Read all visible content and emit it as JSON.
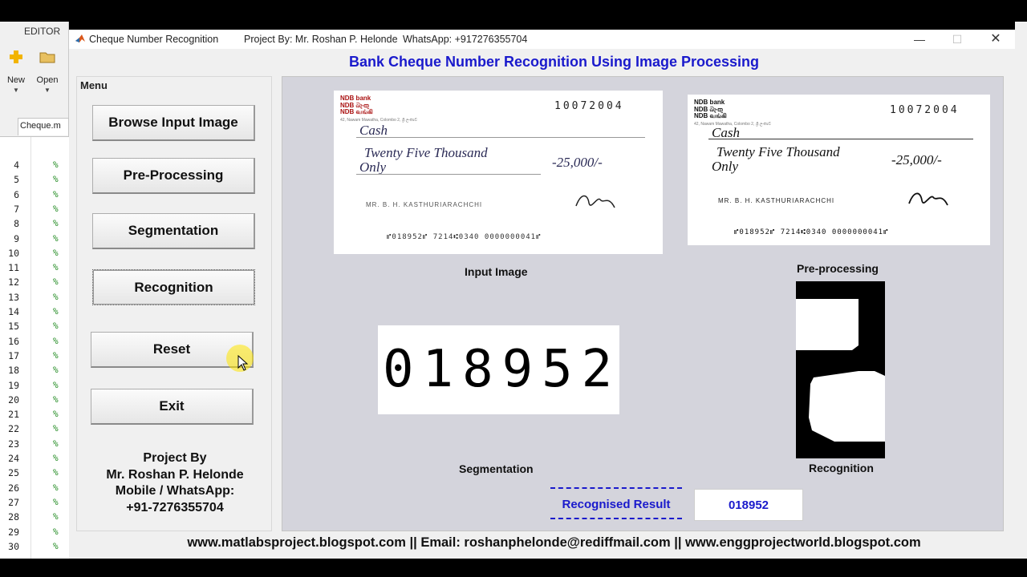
{
  "editor": {
    "title": "EDITOR",
    "new_label": "New",
    "open_label": "Open",
    "tab_label": "Cheque.m",
    "line_numbers": [
      "4",
      "5",
      "6",
      "7",
      "8",
      "9",
      "10",
      "11",
      "12",
      "13",
      "14",
      "15",
      "16",
      "17",
      "18",
      "19",
      "20",
      "21",
      "22",
      "23",
      "24",
      "25",
      "26",
      "27",
      "28",
      "29",
      "30"
    ],
    "comment_char": "%"
  },
  "window": {
    "title": "Cheque Number Recognition",
    "project_by": "Project By: Mr. Roshan P. Helonde",
    "whatsapp": "WhatsApp: +917276355704",
    "minimize_glyph": "—",
    "maximize_glyph": "☐",
    "close_glyph": "✕"
  },
  "app": {
    "heading": "Bank Cheque Number Recognition Using Image Processing",
    "menu_title": "Menu",
    "buttons": {
      "browse": "Browse Input Image",
      "preprocess": "Pre-Processing",
      "segmentation": "Segmentation",
      "recognition": "Recognition",
      "reset": "Reset",
      "exit": "Exit"
    },
    "credit": {
      "line1": "Project By",
      "line2": "Mr. Roshan P. Helonde",
      "line3": "Mobile / WhatsApp:",
      "line4": "+91-7276355704"
    },
    "captions": {
      "input": "Input Image",
      "preprocessing": "Pre-processing",
      "segmentation": "Segmentation",
      "recognition": "Recognition"
    },
    "cheque": {
      "bank": [
        "NDB bank",
        "NDB බැංකු",
        "NDB வங்கி"
      ],
      "date": "10072004",
      "payee": "Cash",
      "amount_words_1": "Twenty Five Thousand",
      "amount_words_2": "Only",
      "amount": "-25,000/-",
      "name": "MR. B. H. KASTHURIARACHCHI",
      "micr": "⑈018952⑈ 7214⑆0340 0000000041⑈"
    },
    "segmented_digits": "018952",
    "result_label": "Recognised Result",
    "result_value": "018952",
    "footer": "www.matlabsproject.blogspot.com  ||  Email: roshanphelonde@rediffmail.com  ||  www.enggprojectworld.blogspot.com"
  },
  "colors": {
    "accent_blue": "#1a1acc",
    "panel_bg": "#d4d4dc",
    "cursor_highlight": "#ffe600"
  }
}
